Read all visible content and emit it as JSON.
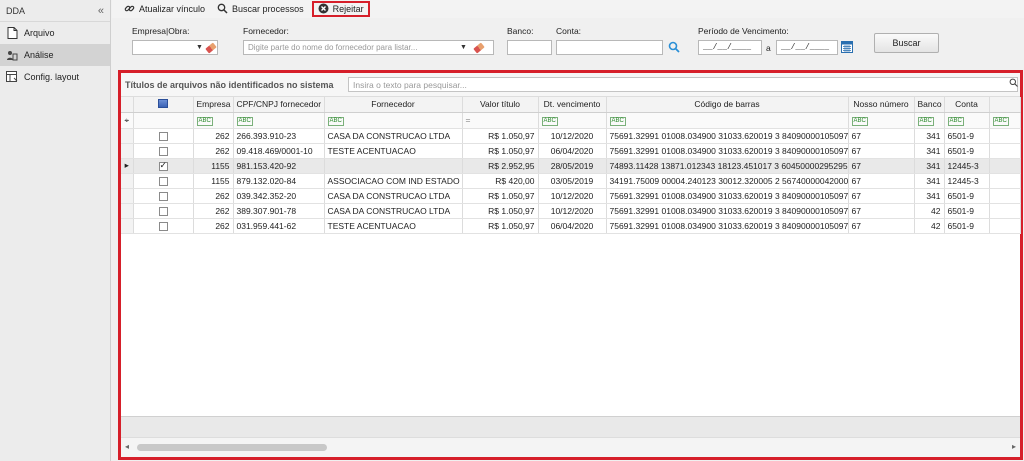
{
  "sidebar": {
    "title": "DDA",
    "collapse_glyph": "«",
    "items": [
      {
        "label": "Arquivo",
        "icon": "document-icon"
      },
      {
        "label": "Análise",
        "icon": "analysis-icon"
      },
      {
        "label": "Config. layout",
        "icon": "layout-icon"
      }
    ]
  },
  "toolbar": {
    "update_link_label": "Atualizar vínculo",
    "search_process_label": "Buscar processos",
    "reject_label": "Rejeitar"
  },
  "filters": {
    "empresa_label": "Empresa|Obra:",
    "fornecedor_label": "Fornecedor:",
    "fornecedor_placeholder": "Digite parte do nome do fornecedor para listar...",
    "banco_label": "Banco:",
    "conta_label": "Conta:",
    "periodo_label": "Período de Vencimento:",
    "date_from": "__/__/____",
    "date_sep": "a",
    "date_to": "__/__/____",
    "search_button": "Buscar"
  },
  "panel": {
    "title": "Títulos de arquivos não identificados no sistema",
    "search_placeholder": "Insira o texto para pesquisar..."
  },
  "table": {
    "columns": [
      "Empresa",
      "CPF/CNPJ fornecedor",
      "Fornecedor",
      "Valor título",
      "Dt. vencimento",
      "Código de barras",
      "Nosso número",
      "Banco",
      "Conta"
    ],
    "rows": [
      {
        "checked": false,
        "empresa": "262",
        "cpf": "266.393.910-23",
        "fornecedor": "CASA DA CONSTRUCAO LTDA",
        "valor": "R$ 1.050,97",
        "vencimento": "10/12/2020",
        "codigo": "75691.32991 01008.034900 31033.620019 3 84090000105097",
        "nosso": "67",
        "banco": "341",
        "conta": "6501-9"
      },
      {
        "checked": false,
        "empresa": "262",
        "cpf": "09.418.469/0001-10",
        "fornecedor": "TESTE ACENTUACAO",
        "valor": "R$ 1.050,97",
        "vencimento": "06/04/2020",
        "codigo": "75691.32991 01008.034900 31033.620019 3 84090000105097",
        "nosso": "67",
        "banco": "341",
        "conta": "6501-9"
      },
      {
        "checked": true,
        "empresa": "1155",
        "cpf": "981.153.420-92",
        "fornecedor": "",
        "valor": "R$ 2.952,95",
        "vencimento": "28/05/2019",
        "codigo": "74893.11428 13871.012343 18123.451017 3 60450000295295",
        "nosso": "67",
        "banco": "341",
        "conta": "12445-3"
      },
      {
        "checked": false,
        "empresa": "1155",
        "cpf": "879.132.020-84",
        "fornecedor": "ASSOCIACAO COM IND ESTADO ...",
        "valor": "R$ 420,00",
        "vencimento": "03/05/2019",
        "codigo": "34191.75009 00004.240123 30012.320005 2 56740000042000",
        "nosso": "67",
        "banco": "341",
        "conta": "12445-3"
      },
      {
        "checked": false,
        "empresa": "262",
        "cpf": "039.342.352-20",
        "fornecedor": "CASA DA CONSTRUCAO LTDA",
        "valor": "R$ 1.050,97",
        "vencimento": "10/12/2020",
        "codigo": "75691.32991 01008.034900 31033.620019 3 84090000105097",
        "nosso": "67",
        "banco": "341",
        "conta": "6501-9"
      },
      {
        "checked": false,
        "empresa": "262",
        "cpf": "389.307.901-78",
        "fornecedor": "CASA DA CONSTRUCAO LTDA",
        "valor": "R$ 1.050,97",
        "vencimento": "10/12/2020",
        "codigo": "75691.32991 01008.034900 31033.620019 3 84090000105097",
        "nosso": "67",
        "banco": "42",
        "conta": "6501-9"
      },
      {
        "checked": false,
        "empresa": "262",
        "cpf": "031.959.441-62",
        "fornecedor": "TESTE ACENTUACAO",
        "valor": "R$ 1.050,97",
        "vencimento": "06/04/2020",
        "codigo": "75691.32991 01008.034900 31033.620019 3 84090000105097",
        "nosso": "67",
        "banco": "42",
        "conta": "6501-9"
      }
    ]
  },
  "colors": {
    "highlight": "#d61f2a",
    "search_icon": "#2a8fd6",
    "calendar_icon": "#2a6fb0"
  }
}
